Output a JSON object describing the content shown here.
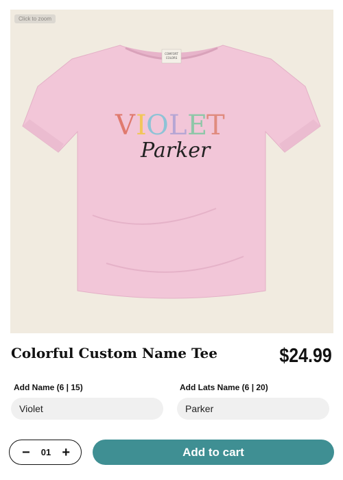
{
  "product": {
    "zoom_hint": "Click to zoom",
    "shirt_text_line1": "VIOLET",
    "shirt_text_line2": "Parker",
    "tag_text": "COMFORT COLORS",
    "title": "Colorful Custom Name Tee",
    "price": "$24.99"
  },
  "form": {
    "first_name_label": "Add Name (6 | 15)",
    "first_name_value": "Violet",
    "last_name_label": "Add Lats Name (6 | 20)",
    "last_name_value": "Parker"
  },
  "cart": {
    "decrement_label": "−",
    "quantity": "01",
    "increment_label": "+",
    "add_button_label": "Add to cart"
  },
  "colors": {
    "shirt": "#f2c6d8",
    "button": "#3f8f93",
    "background": "#f1ebe0"
  }
}
